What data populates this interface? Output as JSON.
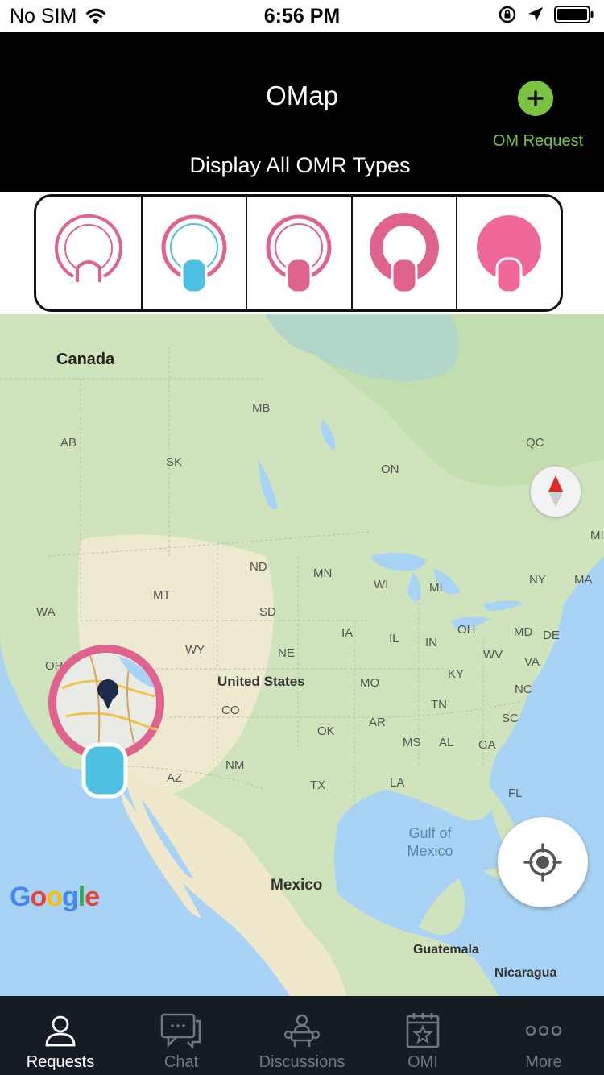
{
  "status": {
    "carrier": "No SIM",
    "time": "6:56 PM"
  },
  "header": {
    "title": "OMap",
    "subtitle": "Display All OMR Types",
    "add_icon": "plus-circle-icon",
    "add_label": "OM Request",
    "accent": "#7bc142"
  },
  "type_filters": {
    "items": [
      {
        "icon": "ring-outline-icon",
        "color": "#e0628f"
      },
      {
        "icon": "ring-blue-icon",
        "color": "#4ec0e3"
      },
      {
        "icon": "ring-pink-tab-icon",
        "color": "#e0628f"
      },
      {
        "icon": "ring-bold-icon",
        "color": "#e0628f"
      },
      {
        "icon": "disc-solid-icon",
        "color": "#f06899"
      }
    ]
  },
  "map": {
    "labels": {
      "canada": "Canada",
      "mb": "MB",
      "ab": "AB",
      "sk": "SK",
      "qc": "QC",
      "on": "ON",
      "mi_edge": "MI",
      "nd": "ND",
      "mn": "MN",
      "mt": "MT",
      "wa": "WA",
      "wi": "WI",
      "mi": "MI",
      "ny": "NY",
      "ma": "MA",
      "sd": "SD",
      "ia": "IA",
      "il": "IL",
      "in": "IN",
      "oh": "OH",
      "md": "MD",
      "de": "DE",
      "wy": "WY",
      "ne": "NE",
      "wv": "WV",
      "va": "VA",
      "or": "OR",
      "us": "United States",
      "mo": "MO",
      "ky": "KY",
      "nc": "NC",
      "co": "CO",
      "tn": "TN",
      "sc": "SC",
      "ok": "OK",
      "ar": "AR",
      "ms": "MS",
      "al": "AL",
      "ga": "GA",
      "nm": "NM",
      "az": "AZ",
      "tx": "TX",
      "la": "LA",
      "fl": "FL",
      "gulf1": "Gulf of",
      "gulf2": "Mexico",
      "mexico": "Mexico",
      "guatemala": "Guatemala",
      "nicaragua": "Nicaragua",
      "google": "Google"
    },
    "compass_icon": "compass-icon",
    "locate_icon": "crosshair-icon",
    "pin_icon": "map-pin-icon"
  },
  "tabs": [
    {
      "label": "Requests",
      "icon": "person-icon",
      "active": true
    },
    {
      "label": "Chat",
      "icon": "chat-icon",
      "active": false
    },
    {
      "label": "Discussions",
      "icon": "group-icon",
      "active": false
    },
    {
      "label": "OMI",
      "icon": "calendar-star-icon",
      "active": false
    },
    {
      "label": "More",
      "icon": "more-dots-icon",
      "active": false
    }
  ]
}
